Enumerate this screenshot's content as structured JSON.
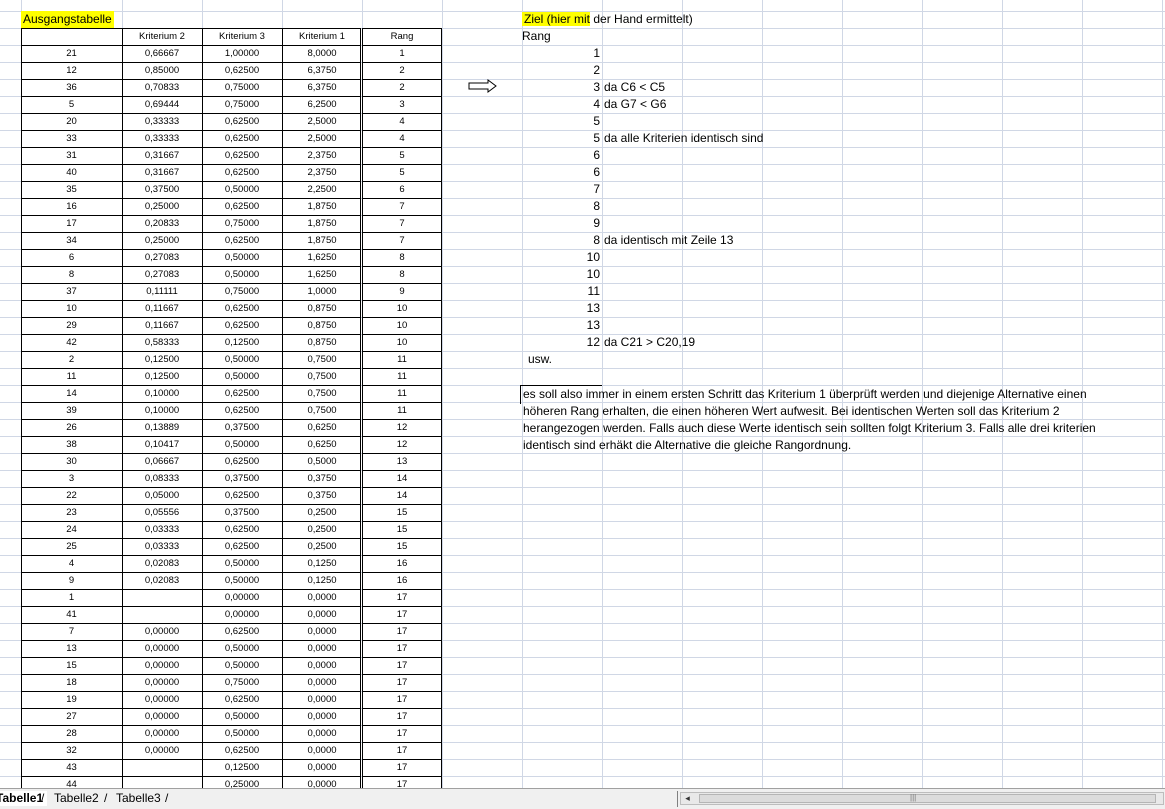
{
  "sheet": {
    "title_source": "Ausgangstabelle",
    "title_target_highlight": "Ziel (hier mit",
    "title_target_rest": " der Hand ermittelt)",
    "colors": {
      "highlight": "#ffff00",
      "grid": "#d0d7e5",
      "border": "#000000"
    },
    "source_table": {
      "headers": [
        "",
        "Kriterium 2",
        "Kriterium 3",
        "Kriterium 1",
        "Rang"
      ],
      "rows": [
        [
          "21",
          "0,66667",
          "1,00000",
          "8,0000",
          "1"
        ],
        [
          "12",
          "0,85000",
          "0,62500",
          "6,3750",
          "2"
        ],
        [
          "36",
          "0,70833",
          "0,75000",
          "6,3750",
          "2"
        ],
        [
          "5",
          "0,69444",
          "0,75000",
          "6,2500",
          "3"
        ],
        [
          "20",
          "0,33333",
          "0,62500",
          "2,5000",
          "4"
        ],
        [
          "33",
          "0,33333",
          "0,62500",
          "2,5000",
          "4"
        ],
        [
          "31",
          "0,31667",
          "0,62500",
          "2,3750",
          "5"
        ],
        [
          "40",
          "0,31667",
          "0,62500",
          "2,3750",
          "5"
        ],
        [
          "35",
          "0,37500",
          "0,50000",
          "2,2500",
          "6"
        ],
        [
          "16",
          "0,25000",
          "0,62500",
          "1,8750",
          "7"
        ],
        [
          "17",
          "0,20833",
          "0,75000",
          "1,8750",
          "7"
        ],
        [
          "34",
          "0,25000",
          "0,62500",
          "1,8750",
          "7"
        ],
        [
          "6",
          "0,27083",
          "0,50000",
          "1,6250",
          "8"
        ],
        [
          "8",
          "0,27083",
          "0,50000",
          "1,6250",
          "8"
        ],
        [
          "37",
          "0,11111",
          "0,75000",
          "1,0000",
          "9"
        ],
        [
          "10",
          "0,11667",
          "0,62500",
          "0,8750",
          "10"
        ],
        [
          "29",
          "0,11667",
          "0,62500",
          "0,8750",
          "10"
        ],
        [
          "42",
          "0,58333",
          "0,12500",
          "0,8750",
          "10"
        ],
        [
          "2",
          "0,12500",
          "0,50000",
          "0,7500",
          "11"
        ],
        [
          "11",
          "0,12500",
          "0,50000",
          "0,7500",
          "11"
        ],
        [
          "14",
          "0,10000",
          "0,62500",
          "0,7500",
          "11"
        ],
        [
          "39",
          "0,10000",
          "0,62500",
          "0,7500",
          "11"
        ],
        [
          "26",
          "0,13889",
          "0,37500",
          "0,6250",
          "12"
        ],
        [
          "38",
          "0,10417",
          "0,50000",
          "0,6250",
          "12"
        ],
        [
          "30",
          "0,06667",
          "0,62500",
          "0,5000",
          "13"
        ],
        [
          "3",
          "0,08333",
          "0,37500",
          "0,3750",
          "14"
        ],
        [
          "22",
          "0,05000",
          "0,62500",
          "0,3750",
          "14"
        ],
        [
          "23",
          "0,05556",
          "0,37500",
          "0,2500",
          "15"
        ],
        [
          "24",
          "0,03333",
          "0,62500",
          "0,2500",
          "15"
        ],
        [
          "25",
          "0,03333",
          "0,62500",
          "0,2500",
          "15"
        ],
        [
          "4",
          "0,02083",
          "0,50000",
          "0,1250",
          "16"
        ],
        [
          "9",
          "0,02083",
          "0,50000",
          "0,1250",
          "16"
        ],
        [
          "1",
          "",
          "0,00000",
          "0,0000",
          "17"
        ],
        [
          "41",
          "",
          "0,00000",
          "0,0000",
          "17"
        ],
        [
          "7",
          "0,00000",
          "0,62500",
          "0,0000",
          "17"
        ],
        [
          "13",
          "0,00000",
          "0,50000",
          "0,0000",
          "17"
        ],
        [
          "15",
          "0,00000",
          "0,50000",
          "0,0000",
          "17"
        ],
        [
          "18",
          "0,00000",
          "0,75000",
          "0,0000",
          "17"
        ],
        [
          "19",
          "0,00000",
          "0,62500",
          "0,0000",
          "17"
        ],
        [
          "27",
          "0,00000",
          "0,50000",
          "0,0000",
          "17"
        ],
        [
          "28",
          "0,00000",
          "0,50000",
          "0,0000",
          "17"
        ],
        [
          "32",
          "0,00000",
          "0,62500",
          "0,0000",
          "17"
        ],
        [
          "43",
          "",
          "0,12500",
          "0,0000",
          "17"
        ],
        [
          "44",
          "",
          "0,25000",
          "0,0000",
          "17"
        ]
      ]
    },
    "target": {
      "header": "Rang",
      "rows": [
        {
          "rank": "1",
          "note": ""
        },
        {
          "rank": "2",
          "note": ""
        },
        {
          "rank": "3",
          "note": "da C6 < C5"
        },
        {
          "rank": "4",
          "note": "da G7 < G6"
        },
        {
          "rank": "5",
          "note": ""
        },
        {
          "rank": "5",
          "note": "da alle Kriterien identisch sind"
        },
        {
          "rank": "6",
          "note": ""
        },
        {
          "rank": "6",
          "note": ""
        },
        {
          "rank": "7",
          "note": ""
        },
        {
          "rank": "8",
          "note": ""
        },
        {
          "rank": "9",
          "note": ""
        },
        {
          "rank": "8",
          "note": "da identisch mit Zeile 13"
        },
        {
          "rank": "10",
          "note": ""
        },
        {
          "rank": "10",
          "note": ""
        },
        {
          "rank": "11",
          "note": ""
        },
        {
          "rank": "13",
          "note": ""
        },
        {
          "rank": "13",
          "note": ""
        },
        {
          "rank": "12",
          "note": "da C21 > C20,19"
        }
      ],
      "usw": "usw."
    },
    "description_lines": [
      "es soll also immer in einem ersten Schritt das Kriterium 1 überprüft werden und diejenige Alternative einen",
      "höheren Rang erhalten, die einen höheren Wert aufwesit. Bei identischen Werten soll das Kriterium 2",
      "herangezogen werden. Falls auch diese Werte identisch sein sollten folgt Kriterium 3. Falls alle drei kriterien",
      "identisch sind erhäkt die Alternative die gleiche Rangordnung."
    ]
  },
  "tabs": [
    {
      "label": "Tabelle1",
      "active": true
    },
    {
      "label": "Tabelle2",
      "active": false
    },
    {
      "label": "Tabelle3",
      "active": false
    }
  ],
  "icons": {
    "arrow": "right-arrow-icon",
    "scroll_left": "scroll-left-icon"
  }
}
